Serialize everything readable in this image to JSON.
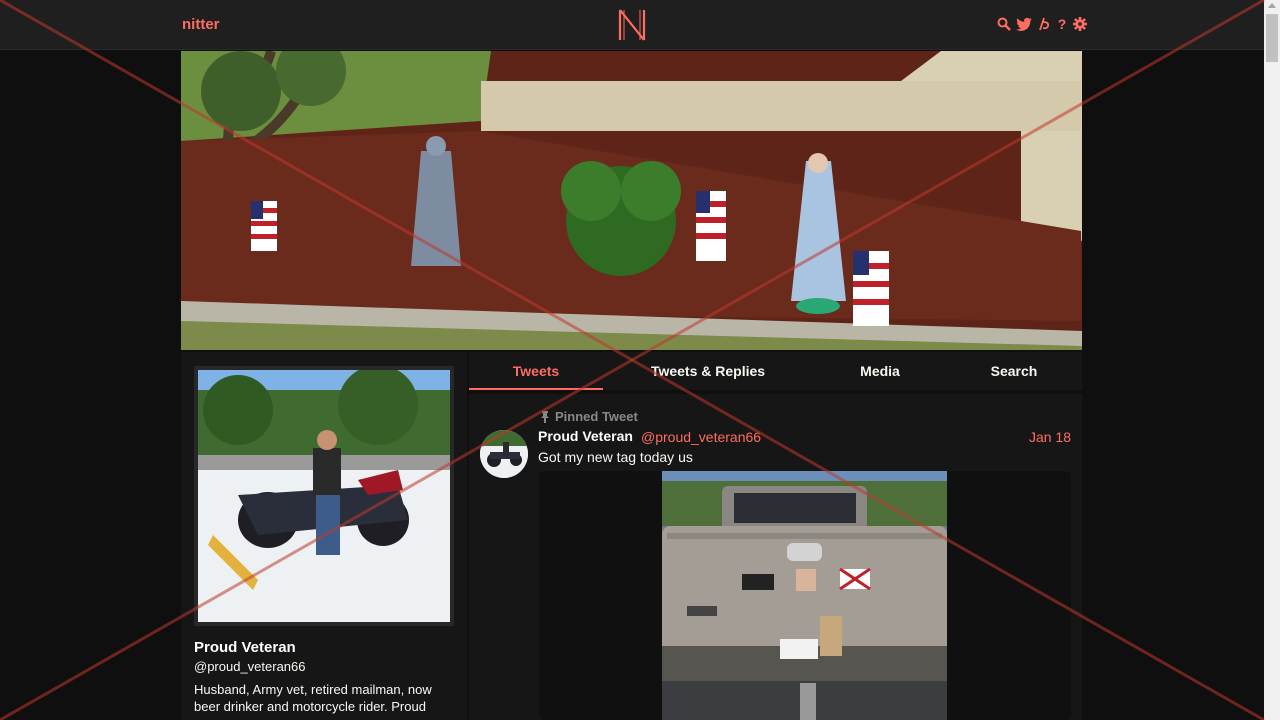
{
  "nav": {
    "brand": "nitter",
    "icons": [
      "search-icon",
      "twitter-icon",
      "rss-icon",
      "help-icon",
      "settings-icon"
    ],
    "help_glyph": "?"
  },
  "profile": {
    "name": "Proud Veteran",
    "handle": "@proud_veteran66",
    "bio": "Husband, Army vet, retired mailman, now beer drinker and motorcycle rider. Proud"
  },
  "tabs": [
    {
      "label": "Tweets",
      "active": true
    },
    {
      "label": "Tweets & Replies",
      "active": false
    },
    {
      "label": "Media",
      "active": false
    },
    {
      "label": "Search",
      "active": false
    }
  ],
  "tweet": {
    "pinned_label": "Pinned Tweet",
    "name": "Proud Veteran",
    "handle": "@proud_veteran66",
    "date": "Jan 18",
    "text": "Got my new tag today us"
  },
  "colors": {
    "accent": "#ff6c60",
    "background": "#0f0f0f",
    "panel": "#161616"
  }
}
